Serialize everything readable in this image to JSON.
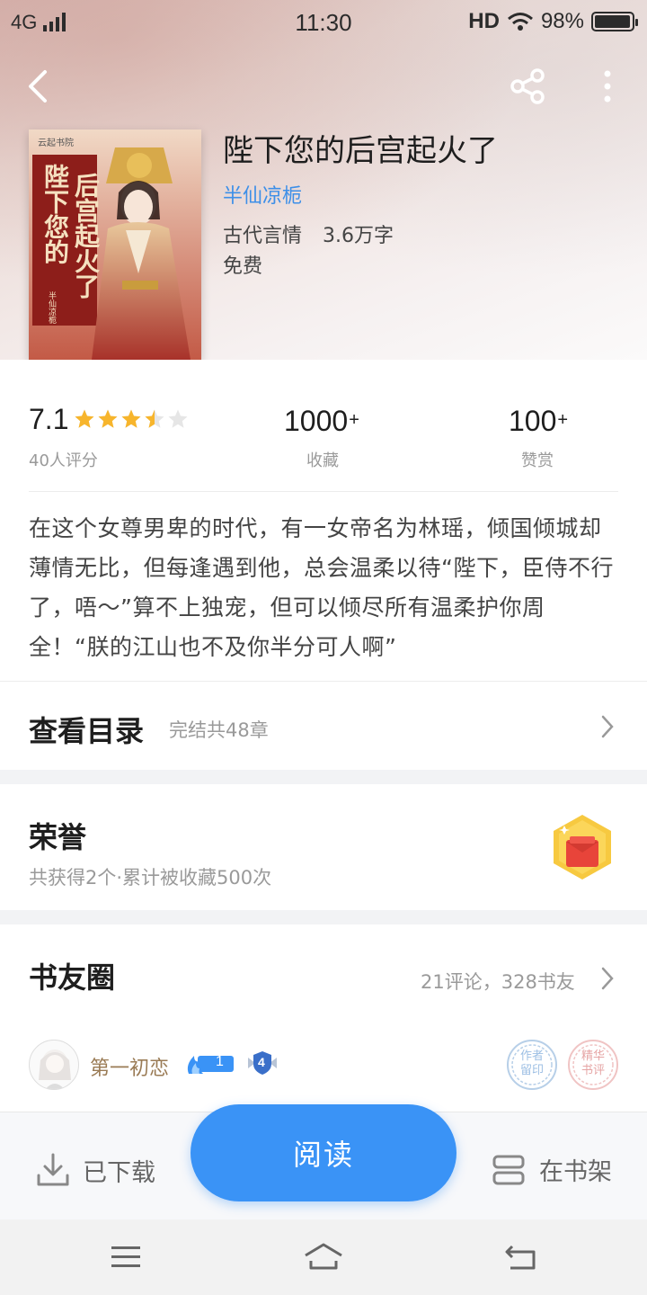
{
  "status_bar": {
    "network": "4G",
    "time": "11:30",
    "hd": "HD",
    "battery_text": "98%",
    "battery_level": 0.98
  },
  "nav": {
    "back_icon": "chevron-left-icon",
    "share_icon": "share-icon",
    "more_icon": "more-vertical-icon"
  },
  "book": {
    "title": "陛下您的后宫起火了",
    "author": "半仙凉栀",
    "category": "古代言情",
    "word_count": "3.6万字",
    "price": "免费",
    "cover": {
      "publisher": "云起书院",
      "title_line1": "陛下您的",
      "title_line2": "后宫起火了",
      "author_seal": "半仙凉栀"
    }
  },
  "stats": {
    "score": "7.1",
    "rating": 3.5,
    "rating_max": 5,
    "score_label": "40人评分",
    "favorites_value": "1000",
    "favorites_plus": "+",
    "favorites_label": "收藏",
    "rewards_value": "100",
    "rewards_plus": "+",
    "rewards_label": "赞赏"
  },
  "intro": "在这个女尊男卑的时代，有一女帝名为林瑶，倾国倾城却薄情无比，但每逢遇到他，总会温柔以待“陛下，臣侍不行了，唔～”算不上独宠，但可以倾尽所有温柔护你周全！“朕的江山也不及你半分可人啊”",
  "catalog": {
    "title": "查看目录",
    "subtitle": "完结共48章"
  },
  "honor": {
    "title": "荣誉",
    "subtitle": "共获得2个·累计被收藏500次",
    "icon": "red-envelope-badge-icon"
  },
  "circle": {
    "title": "书友圈",
    "summary": "21评论，328书友",
    "user": {
      "name": "第一初恋",
      "fire_level": "1",
      "level_badge": "4"
    },
    "stamps": [
      "作者留印",
      "精华书评"
    ]
  },
  "actions": {
    "downloaded": "已下载",
    "read": "阅读",
    "on_shelf": "在书架"
  },
  "system_nav": {
    "menu_icon": "menu-icon",
    "home_icon": "home-icon",
    "back_icon": "return-icon"
  }
}
